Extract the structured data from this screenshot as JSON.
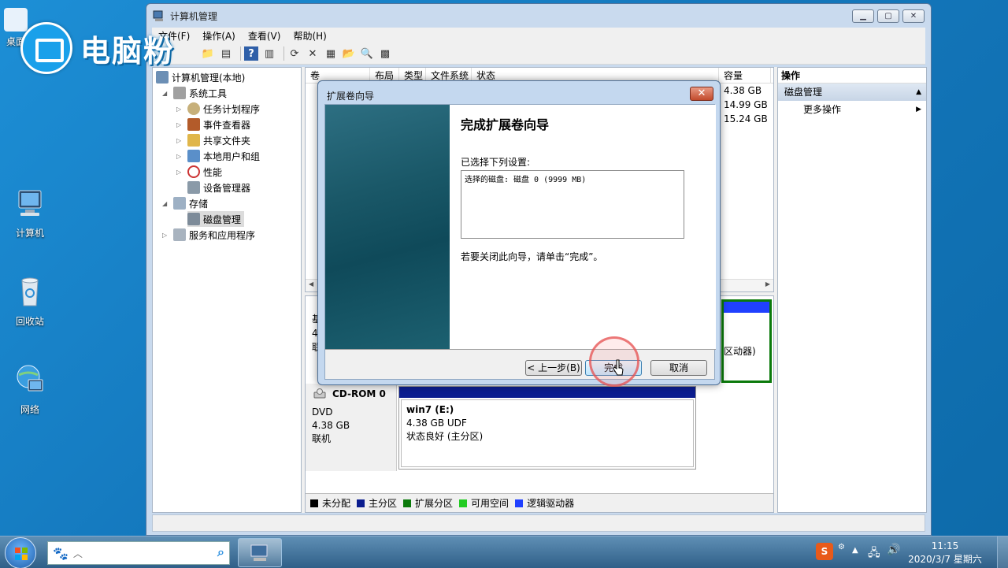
{
  "desktop": {
    "icons": [
      {
        "label": "桌面"
      },
      {
        "label": "计算机"
      },
      {
        "label": "回收站"
      },
      {
        "label": "网络"
      }
    ]
  },
  "watermark": {
    "text": "电脑粉"
  },
  "window": {
    "title": "计算机管理",
    "menu": [
      "文件(F)",
      "操作(A)",
      "查看(V)",
      "帮助(H)"
    ],
    "tree": {
      "root": "计算机管理(本地)",
      "system_tools": "系统工具",
      "task_scheduler": "任务计划程序",
      "event_viewer": "事件查看器",
      "shared_folders": "共享文件夹",
      "local_users": "本地用户和组",
      "performance": "性能",
      "device_manager": "设备管理器",
      "storage": "存储",
      "disk_management": "磁盘管理",
      "services_apps": "服务和应用程序"
    },
    "volume_table": {
      "columns": [
        "卷",
        "布局",
        "类型",
        "文件系统",
        "状态",
        "容量"
      ],
      "capacities": [
        "4.38 GB",
        "14.99 GB",
        "15.24 GB"
      ]
    },
    "cdrom": {
      "name": "CD-ROM 0",
      "type": "DVD",
      "size": "4.38 GB",
      "status": "联机",
      "volume_name": "win7  (E:)",
      "volume_size": "4.38 GB UDF",
      "volume_status": "状态良好 (主分区)"
    },
    "partial_disk": {
      "line1": "基",
      "line2": "4",
      "line3": "联",
      "volume_fragment": "区动器)"
    },
    "legend": [
      {
        "label": "未分配",
        "color": "#000000"
      },
      {
        "label": "主分区",
        "color": "#0b1d8f"
      },
      {
        "label": "扩展分区",
        "color": "#0b7a0b"
      },
      {
        "label": "可用空间",
        "color": "#22cc22"
      },
      {
        "label": "逻辑驱动器",
        "color": "#2040ff"
      }
    ],
    "actions": {
      "header": "操作",
      "section": "磁盘管理",
      "more": "更多操作"
    }
  },
  "dialog": {
    "title": "扩展卷向导",
    "heading": "完成扩展卷向导",
    "selected_label": "已选择下列设置:",
    "settings_text": "选择的磁盘: 磁盘 0 (9999 MB)",
    "close_hint": "若要关闭此向导，请单击“完成”。",
    "back_button": "< 上一步(B)",
    "finish_button": "完成",
    "cancel_button": "取消"
  },
  "taskbar": {
    "time": "11:15",
    "date": "2020/3/7 星期六"
  }
}
